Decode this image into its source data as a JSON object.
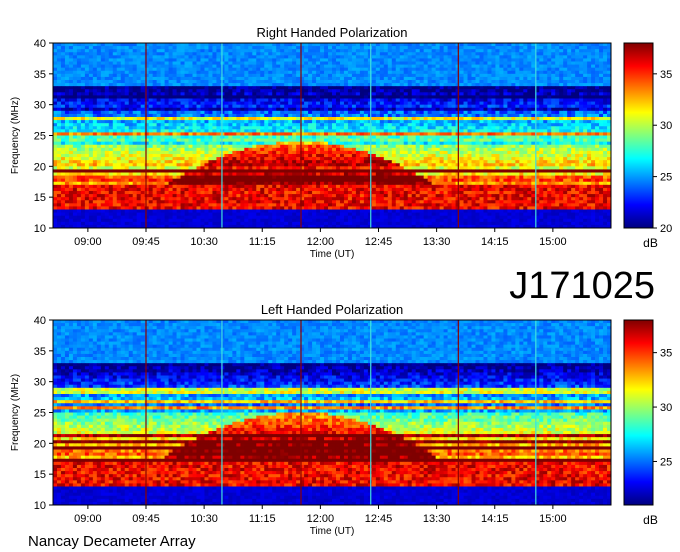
{
  "header": {
    "observation_id": "J171025"
  },
  "footer": {
    "instrument": "Nancay Decameter Array"
  },
  "colors": {
    "colormap": [
      "#00007f",
      "#0000ff",
      "#007fff",
      "#00ffff",
      "#7fff7f",
      "#ffff00",
      "#ff7f00",
      "#ff0000",
      "#7f0000"
    ]
  },
  "chart_data": [
    {
      "type": "heatmap",
      "title": "Right Handed Polarization",
      "xlabel": "Time (UT)",
      "ylabel": "Frequency (MHz)",
      "x_ticks": [
        "09:00",
        "09:45",
        "10:30",
        "11:15",
        "12:00",
        "12:45",
        "13:30",
        "14:15",
        "15:00"
      ],
      "x_tick_hours": [
        9.0,
        9.75,
        10.5,
        11.25,
        12.0,
        12.75,
        13.5,
        14.25,
        15.0
      ],
      "xlim_hours": [
        8.55,
        15.75
      ],
      "y_ticks": [
        10,
        15,
        20,
        25,
        30,
        35,
        40
      ],
      "ylim": [
        10,
        40
      ],
      "colorbar": {
        "label": "dB",
        "ticks": [
          20,
          25,
          30,
          35
        ],
        "range": [
          20,
          38
        ]
      },
      "features": {
        "emission_peak_time": 11.75,
        "emission_peak_freq": 24,
        "vertical_lines_hours": [
          9.75,
          10.73,
          11.75,
          12.65,
          13.78,
          14.78
        ]
      }
    },
    {
      "type": "heatmap",
      "title": "Left Handed Polarization",
      "xlabel": "Time (UT)",
      "ylabel": "Frequency (MHz)",
      "x_ticks": [
        "09:00",
        "09:45",
        "10:30",
        "11:15",
        "12:00",
        "12:45",
        "13:30",
        "14:15",
        "15:00"
      ],
      "x_tick_hours": [
        9.0,
        9.75,
        10.5,
        11.25,
        12.0,
        12.75,
        13.5,
        14.25,
        15.0
      ],
      "xlim_hours": [
        8.55,
        15.75
      ],
      "y_ticks": [
        10,
        15,
        20,
        25,
        30,
        35,
        40
      ],
      "ylim": [
        10,
        40
      ],
      "colorbar": {
        "label": "dB",
        "ticks": [
          25,
          30,
          35
        ],
        "range": [
          21,
          38
        ]
      },
      "features": {
        "emission_peak_time": 11.75,
        "emission_peak_freq": 25,
        "vertical_lines_hours": [
          9.75,
          10.73,
          11.75,
          12.65,
          13.78,
          14.78
        ]
      }
    }
  ]
}
